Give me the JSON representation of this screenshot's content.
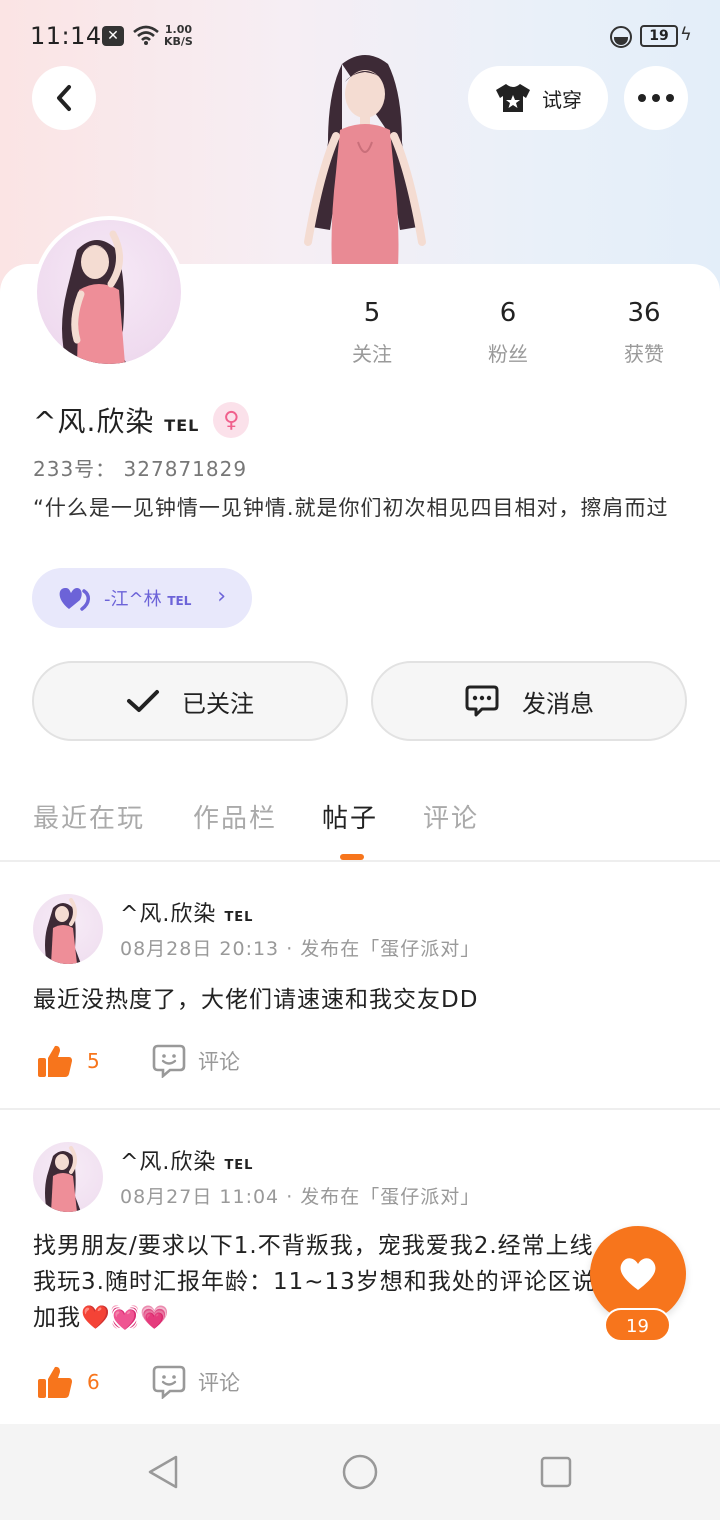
{
  "status_bar": {
    "time": "11:14",
    "net_speed_value": "1.00",
    "net_speed_unit": "KB/S",
    "battery": "19"
  },
  "header": {
    "try_on_label": "试穿"
  },
  "profile": {
    "stats": [
      {
        "value": "5",
        "label": "关注"
      },
      {
        "value": "6",
        "label": "粉丝"
      },
      {
        "value": "36",
        "label": "获赞"
      }
    ],
    "name": "^风.欣染",
    "name_tag": "TEL",
    "gender_icon": "female-icon",
    "uid_label": "233号：",
    "uid": "327871829",
    "bio": "“什么是一见钟情一见钟情.就是你们初次相见四目相对，擦肩而过",
    "cp_name": "-江^林",
    "cp_tag": "TEL",
    "followed_label": "已关注",
    "message_label": "发消息"
  },
  "tabs": [
    {
      "label": "最近在玩",
      "active": false
    },
    {
      "label": "作品栏",
      "active": false
    },
    {
      "label": "帖子",
      "active": true
    },
    {
      "label": "评论",
      "active": false
    }
  ],
  "posts": [
    {
      "author": "^风.欣染",
      "author_tag": "TEL",
      "meta": "08月28日 20:13 · 发布在「蛋仔派对」",
      "text": "最近没热度了，大佬们请速速和我交友DD",
      "likes": "5",
      "comment_label": "评论"
    },
    {
      "author": "^风.欣染",
      "author_tag": "TEL",
      "meta": "08月27日 11:04 · 发布在「蛋仔派对」",
      "text": "找男朋友/要求以下1.不背叛我，宠我爱我2.经常上线，陪我玩3.随时汇报年龄：11~13岁想和我处的评论区说并且加我❤️💓💗",
      "likes": "6",
      "comment_label": "评论"
    }
  ],
  "fab": {
    "count": "19"
  },
  "colors": {
    "accent": "#f7751c",
    "cp_purple": "#6c63d8",
    "gender_pink": "#f0608c"
  }
}
